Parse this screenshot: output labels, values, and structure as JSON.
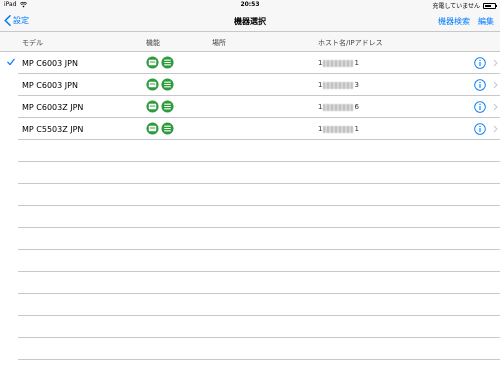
{
  "status_bar": {
    "device": "iPad",
    "time": "20:53",
    "charging": "充電していません",
    "battery_level": 0.6
  },
  "nav": {
    "back_label": "設定",
    "title": "機器選択",
    "search_label": "機器検索",
    "edit_label": "編集"
  },
  "columns": {
    "model": "モデル",
    "function": "機能",
    "location": "場所",
    "host": "ホスト名/IPアドレス"
  },
  "rows": [
    {
      "model": "MP C6003 JPN",
      "host_prefix": "1",
      "host_suffix": "1",
      "selected": true
    },
    {
      "model": "MP C6003 JPN",
      "host_prefix": "1",
      "host_suffix": "3",
      "selected": false
    },
    {
      "model": "MP C6003Z JPN",
      "host_prefix": "1",
      "host_suffix": "6",
      "selected": false
    },
    {
      "model": "MP C5503Z JPN",
      "host_prefix": "1",
      "host_suffix": "1",
      "selected": false
    }
  ],
  "colors": {
    "accent": "#007aff",
    "function_icon": "#2e9c3c",
    "separator": "#c8c7cc"
  },
  "icons": {
    "function_1": "scan-icon",
    "function_2": "print-icon",
    "row_info": "info-circle-icon",
    "row_disclosure": "chevron-right-icon"
  }
}
